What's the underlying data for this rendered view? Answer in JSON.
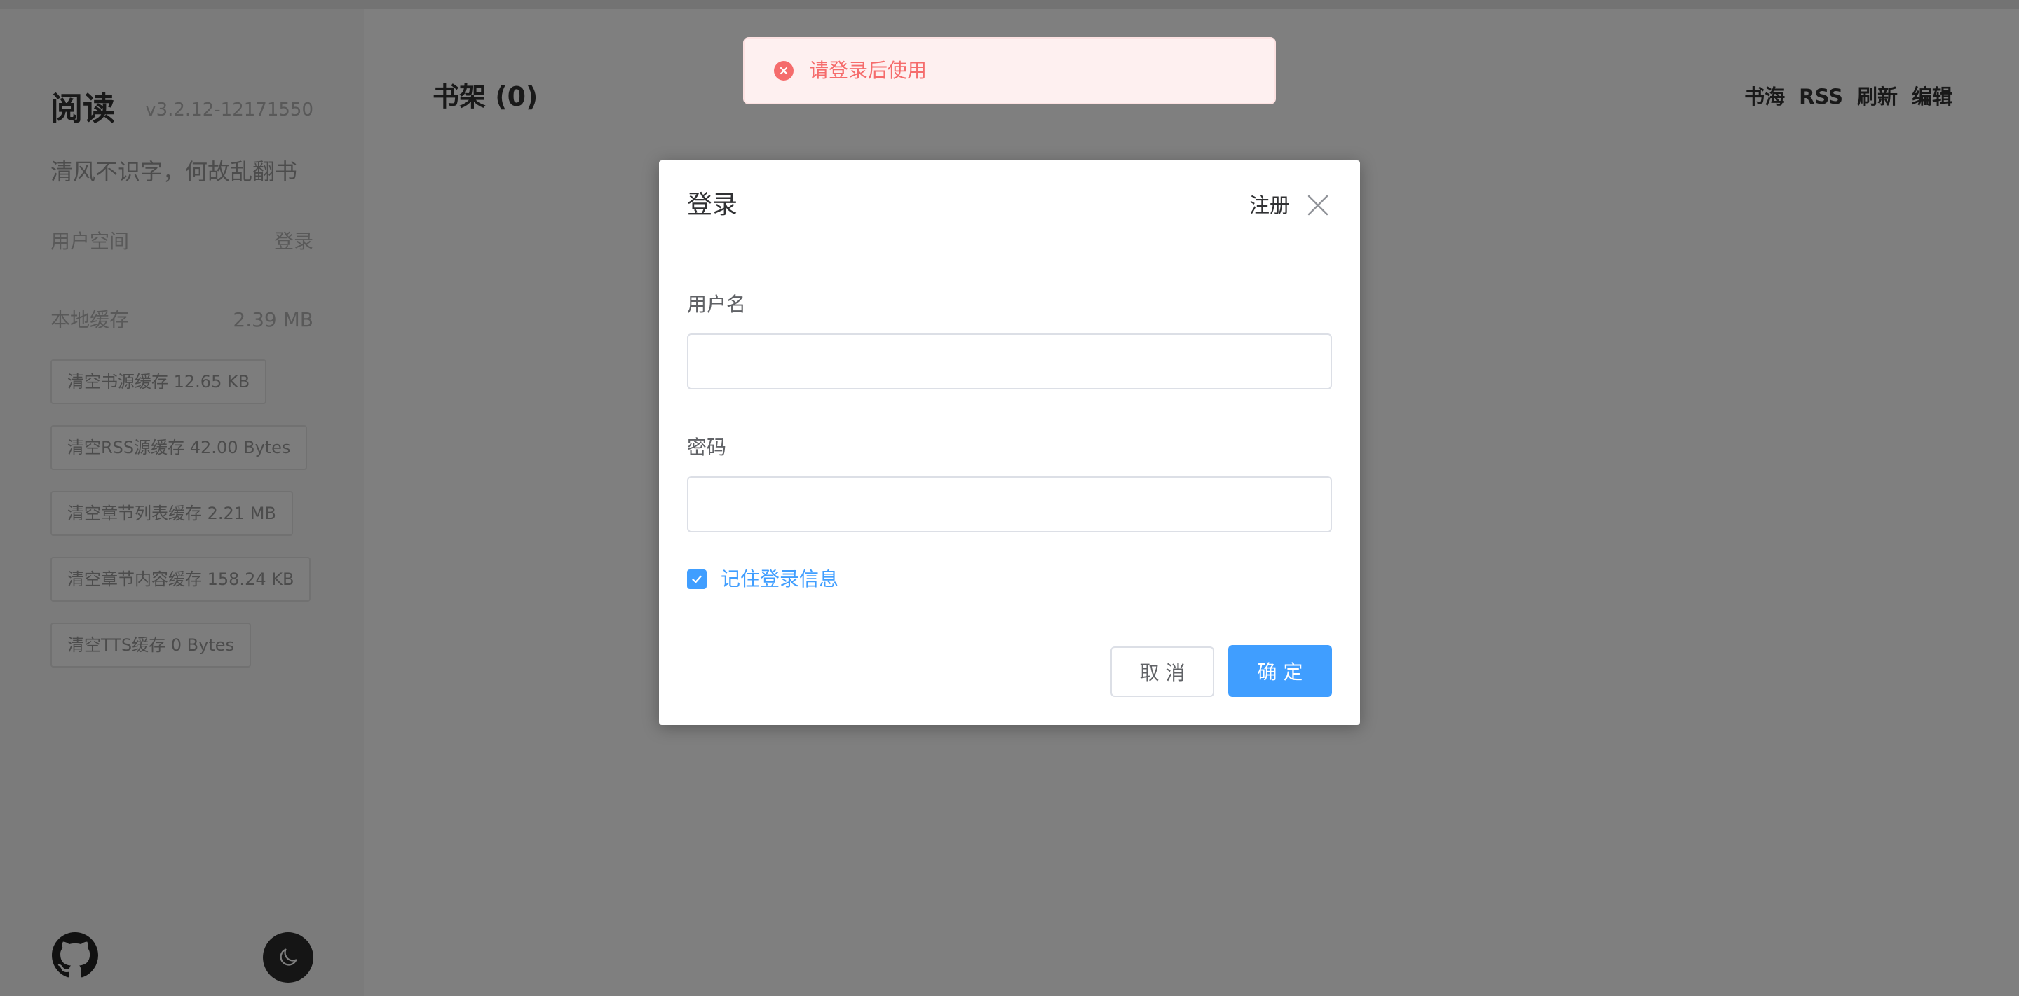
{
  "sidebar": {
    "title": "阅读",
    "version": "v3.2.12-12171550",
    "slogan": "清风不识字，何故乱翻书",
    "user_space_label": "用户空间",
    "login_link": "登录",
    "local_cache_label": "本地缓存",
    "local_cache_size": "2.39 MB",
    "cache_buttons": [
      "清空书源缓存 12.65 KB",
      "清空RSS源缓存 42.00 Bytes",
      "清空章节列表缓存 2.21 MB",
      "清空章节内容缓存 158.24 KB",
      "清空TTS缓存 0 Bytes"
    ],
    "github_icon": "github-icon",
    "theme_icon": "moon-icon"
  },
  "main": {
    "shelf_title": "书架 (0)",
    "nav": [
      "书海",
      "RSS",
      "刷新",
      "编辑"
    ]
  },
  "toast": {
    "icon": "error-circle-icon",
    "message": "请登录后使用"
  },
  "dialog": {
    "title": "登录",
    "register_link": "注册",
    "username_label": "用户名",
    "username_value": "",
    "password_label": "密码",
    "password_value": "",
    "remember_label": "记住登录信息",
    "remember_checked": true,
    "cancel_label": "取 消",
    "confirm_label": "确 定"
  },
  "colors": {
    "primary": "#409eff",
    "error": "#f56c6c",
    "error_bg": "#fef0f0",
    "overlay": "rgba(0,0,0,0.5)"
  }
}
